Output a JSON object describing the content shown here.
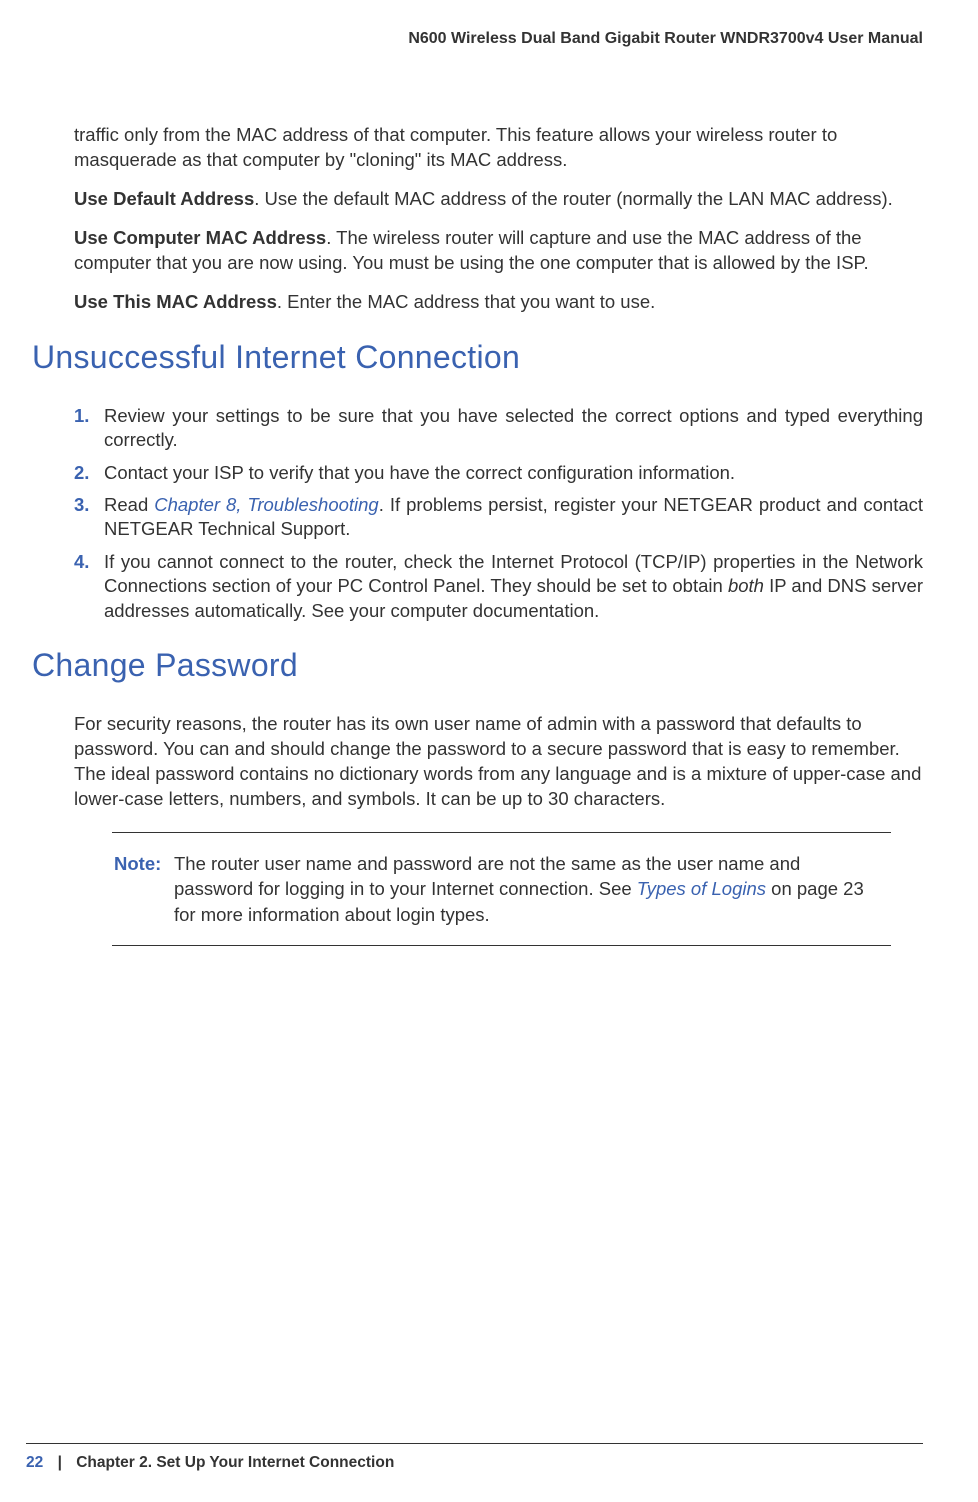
{
  "header": {
    "title": "N600 Wireless Dual Band Gigabit Router WNDR3700v4 User Manual"
  },
  "continuation_text": "traffic only from the MAC address of that computer. This feature allows your wireless router to masquerade as that computer by \"cloning\" its MAC address.",
  "paragraphs": [
    {
      "bold": "Use Default Address",
      "text": ". Use the default MAC address of the router (normally the LAN MAC address)."
    },
    {
      "bold": "Use Computer MAC Address",
      "text": ". The wireless router will capture and use the MAC address of the computer that you are now using. You must be using the one computer that is allowed by the ISP."
    },
    {
      "bold": "Use This MAC Address",
      "text": ". Enter the MAC address that you want to use."
    }
  ],
  "section1": {
    "heading": "Unsuccessful Internet Connection",
    "items": [
      {
        "prefix": "",
        "link": "",
        "text": "Review your settings to be sure that you have selected the correct options and typed everything correctly."
      },
      {
        "prefix": "",
        "link": "",
        "text": "Contact your ISP to verify that you have the correct configuration information."
      },
      {
        "prefix": "Read ",
        "link": "Chapter 8, Troubleshooting",
        "text": ". If problems persist, register your NETGEAR product and contact NETGEAR Technical Support."
      },
      {
        "prefix": "If you cannot connect to the router, check the Internet Protocol (TCP/IP) properties in the Network Connections section of your PC Control Panel. They should be set to obtain ",
        "italic": "both",
        "text": " IP and DNS server addresses automatically. See your computer documentation."
      }
    ]
  },
  "section2": {
    "heading": "Change Password",
    "body": "For security reasons, the router has its own user name of admin with a password that defaults to password. You can and should change the password to a secure password that is easy to remember. The ideal password contains no dictionary words from any language and is a mixture of upper-case and lower-case letters, numbers, and symbols. It can be up to 30 characters."
  },
  "note": {
    "label": "Note:",
    "line1": "The router user name and password are not the same as the user name and password for logging in to your Internet connection. See ",
    "link": "Types of Logins",
    "line2": " on page 23 for more information about login types."
  },
  "footer": {
    "page": "22",
    "sep": "|",
    "chapter": "Chapter 2.  Set Up Your Internet Connection"
  }
}
